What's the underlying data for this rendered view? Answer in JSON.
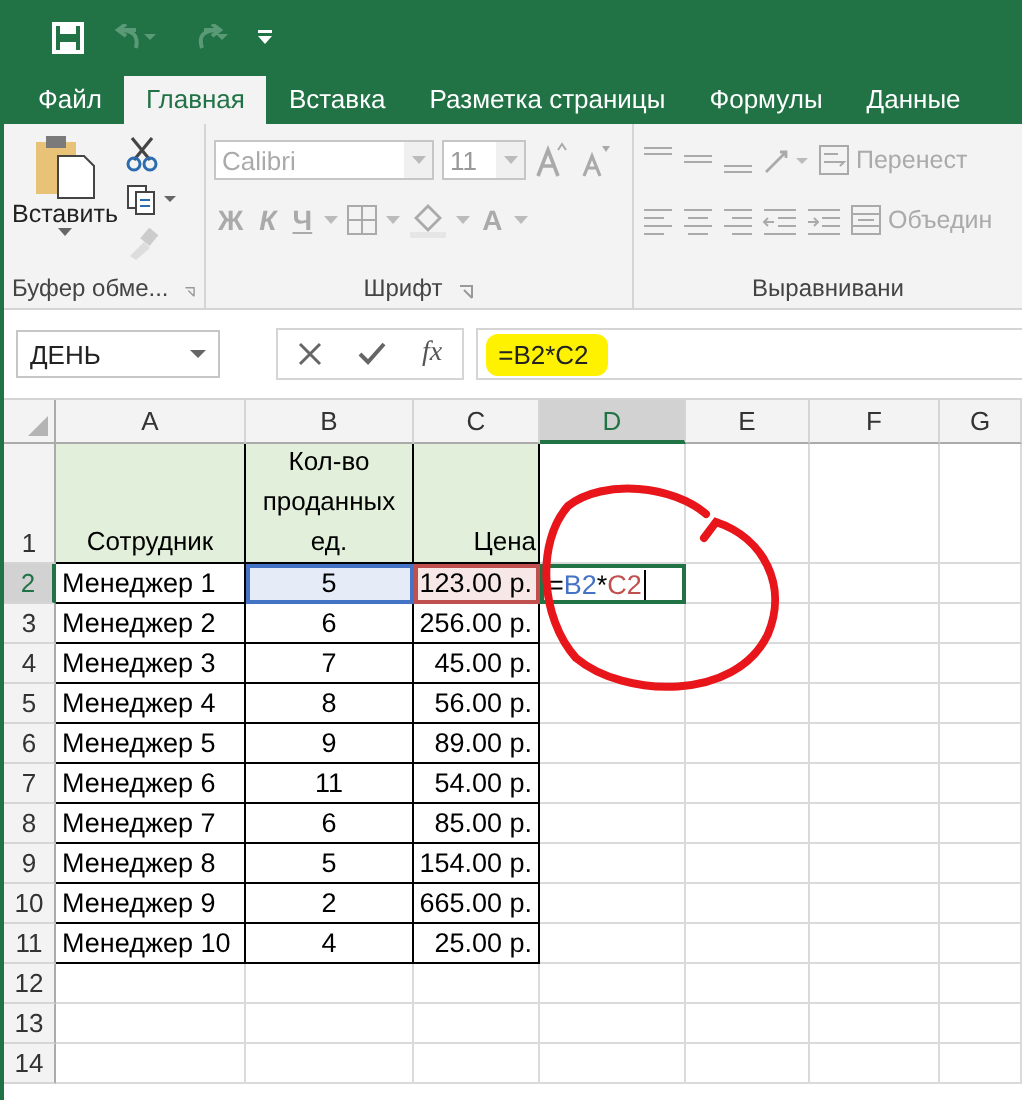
{
  "tabs": [
    {
      "label": "Файл",
      "selected": false
    },
    {
      "label": "Главная",
      "selected": true
    },
    {
      "label": "Вставка",
      "selected": false
    },
    {
      "label": "Разметка страницы",
      "selected": false
    },
    {
      "label": "Формулы",
      "selected": false
    },
    {
      "label": "Данные",
      "selected": false
    }
  ],
  "ribbon": {
    "disabled": true,
    "clipboard": {
      "paste_label": "Вставить",
      "group_label": "Буфер обме..."
    },
    "font": {
      "font_name": "Calibri",
      "font_size": "11",
      "bold": "Ж",
      "italic": "К",
      "underline": "Ч",
      "font_color": "A",
      "group_label": "Шрифт"
    },
    "alignment": {
      "wrap_label": "Перенест",
      "merge_label": "Объедин",
      "group_label": "Выравнивани"
    }
  },
  "formula_bar": {
    "name_box": "ДЕНЬ",
    "function_button": "fx",
    "formula": "=B2*C2",
    "highlighted": true
  },
  "sheet": {
    "columns": [
      {
        "label": "A",
        "selected": false
      },
      {
        "label": "B",
        "selected": false
      },
      {
        "label": "C",
        "selected": false
      },
      {
        "label": "D",
        "selected": true
      },
      {
        "label": "E",
        "selected": false
      },
      {
        "label": "F",
        "selected": false
      },
      {
        "label": "G",
        "selected": false
      }
    ],
    "rows": [
      {
        "header": "1",
        "selected": false,
        "kind": "heading",
        "cells": [
          "Сотрудник",
          "Кол-во проданных ед.",
          "Цена"
        ]
      },
      {
        "header": "2",
        "selected": true,
        "kind": "data",
        "cells": [
          {
            "text": "Менеджер 1"
          },
          {
            "text": "5",
            "color": "#4472c4"
          },
          {
            "text": "123.00 р.",
            "color": "#c0504d"
          }
        ],
        "editing": [
          {
            "text": "=",
            "kind": "operator"
          },
          {
            "text": "B2",
            "kind": "ref",
            "color": "#4472c4"
          },
          {
            "text": "*",
            "kind": "operator"
          },
          {
            "text": "C2",
            "kind": "ref",
            "color": "#c0504d"
          }
        ]
      },
      {
        "header": "3",
        "selected": false,
        "kind": "data",
        "cells": [
          "Менеджер 2",
          "6",
          "256.00 р."
        ]
      },
      {
        "header": "4",
        "selected": false,
        "kind": "data",
        "cells": [
          "Менеджер 3",
          "7",
          "45.00 р."
        ]
      },
      {
        "header": "5",
        "selected": false,
        "kind": "data",
        "cells": [
          "Менеджер 4",
          "8",
          "56.00 р."
        ]
      },
      {
        "header": "6",
        "selected": false,
        "kind": "data",
        "cells": [
          "Менеджер 5",
          "9",
          "89.00 р."
        ]
      },
      {
        "header": "7",
        "selected": false,
        "kind": "data",
        "cells": [
          "Менеджер 6",
          "11",
          "54.00 р."
        ]
      },
      {
        "header": "8",
        "selected": false,
        "kind": "data",
        "cells": [
          "Менеджер 7",
          "6",
          "85.00 р."
        ]
      },
      {
        "header": "9",
        "selected": false,
        "kind": "data",
        "cells": [
          "Менеджер 8",
          "5",
          "154.00 р."
        ]
      },
      {
        "header": "10",
        "selected": false,
        "kind": "data",
        "cells": [
          "Менеджер 9",
          "2",
          "665.00 р."
        ]
      },
      {
        "header": "11",
        "selected": false,
        "kind": "data",
        "cells": [
          "Менеджер 10",
          "4",
          "25.00 р."
        ]
      },
      {
        "header": "12",
        "selected": false,
        "kind": "empty",
        "cells": []
      },
      {
        "header": "13",
        "selected": false,
        "kind": "empty",
        "cells": []
      },
      {
        "header": "14",
        "selected": false,
        "kind": "empty",
        "cells": []
      }
    ]
  }
}
